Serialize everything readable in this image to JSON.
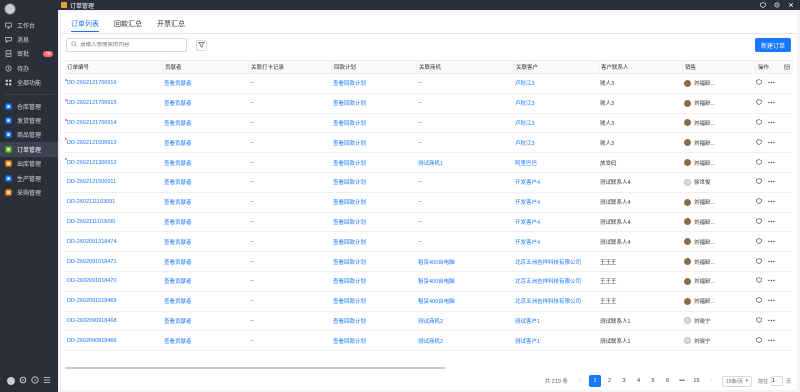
{
  "app": {
    "title": "订单管理"
  },
  "sidebar": {
    "items": [
      {
        "label": "工作台",
        "icon": "monitor-icon"
      },
      {
        "label": "消息",
        "icon": "message-icon"
      },
      {
        "label": "审批",
        "icon": "approval-icon",
        "badge": "76"
      },
      {
        "label": "待办",
        "icon": "todo-icon"
      },
      {
        "label": "全部功能",
        "icon": "grid-icon"
      }
    ],
    "modules": [
      {
        "label": "仓库管理",
        "color": "#1677ff"
      },
      {
        "label": "发货管理",
        "color": "#1677ff"
      },
      {
        "label": "商品管理",
        "color": "#1677ff"
      },
      {
        "label": "订单管理",
        "color": "#52c41a",
        "active": true
      },
      {
        "label": "出库管理",
        "color": "#fa8c16"
      },
      {
        "label": "生产管理",
        "color": "#1677ff"
      },
      {
        "label": "采购管理",
        "color": "#fa8c16"
      }
    ]
  },
  "tabs": [
    {
      "label": "订单列表",
      "active": true
    },
    {
      "label": "回款汇总"
    },
    {
      "label": "开票汇总"
    }
  ],
  "search": {
    "placeholder": "请输入想搜索的内容"
  },
  "toolbar": {
    "new_label": "新建订单"
  },
  "columns": [
    "订单编号",
    "贡献者",
    "关联打卡记录",
    "回款计划",
    "关联商机",
    "关联客户",
    "客户联系人",
    "销售",
    "操作"
  ],
  "rows": [
    {
      "id": "DD-2602121706916",
      "contrib": "查看贡献者",
      "checkin": "--",
      "plan": "查看回款计划",
      "opp": "--",
      "customer": "卢秋江3",
      "contact": "贱人3",
      "sales": "刘福龄...",
      "flag": true,
      "light": false
    },
    {
      "id": "DD-2602121706915",
      "contrib": "查看贡献者",
      "checkin": "--",
      "plan": "查看回款计划",
      "opp": "--",
      "customer": "卢秋江3",
      "contact": "贱人3",
      "sales": "刘福龄...",
      "flag": true,
      "light": false
    },
    {
      "id": "DD-2602121706914",
      "contrib": "查看贡献者",
      "checkin": "--",
      "plan": "查看回款计划",
      "opp": "--",
      "customer": "卢秋江3",
      "contact": "贱人3",
      "sales": "刘福龄...",
      "flag": true,
      "light": false
    },
    {
      "id": "DD-2602121506913",
      "contrib": "查看贡献者",
      "checkin": "--",
      "plan": "查看回款计划",
      "opp": "--",
      "customer": "卢秋江3",
      "contact": "贱人3",
      "sales": "刘福龄...",
      "flag": true,
      "light": false
    },
    {
      "id": "DD-2602121306912",
      "contrib": "查看贡献者",
      "checkin": "--",
      "plan": "查看回款计划",
      "opp": "测试商机1",
      "customer": "阿里巴巴",
      "contact": "放发码",
      "sales": "刘福龄...",
      "flag": true,
      "light": false
    },
    {
      "id": "DD-2602121506911",
      "contrib": "查看贡献者",
      "checkin": "--",
      "plan": "查看回款计划",
      "opp": "--",
      "customer": "开发客户4",
      "contact": "测试联系人4",
      "sales": "徐世俊",
      "flag": false,
      "light": true
    },
    {
      "id": "DD-2602111103091",
      "contrib": "查看贡献者",
      "checkin": "--",
      "plan": "查看回款计划",
      "opp": "--",
      "customer": "开发客户4",
      "contact": "测试联系人4",
      "sales": "刘福龄...",
      "flag": false,
      "light": false
    },
    {
      "id": "DD-2602111103090",
      "contrib": "查看贡献者",
      "checkin": "--",
      "plan": "查看回款计划",
      "opp": "--",
      "customer": "开发客户4",
      "contact": "测试联系人4",
      "sales": "刘福龄...",
      "flag": false,
      "light": false
    },
    {
      "id": "DD-2602091318474",
      "contrib": "查看贡献者",
      "checkin": "--",
      "plan": "查看回款计划",
      "opp": "--",
      "customer": "开发客户4",
      "contact": "测试联系人4",
      "sales": "刘福龄...",
      "flag": false,
      "light": false
    },
    {
      "id": "DD-2602091018471",
      "contrib": "查看贡献者",
      "checkin": "--",
      "plan": "查看回款计划",
      "opp": "租赁400台电脑",
      "customer": "北京五洲吉祥科技有限公司",
      "contact": "王王王",
      "sales": "刘福龄...",
      "flag": false,
      "light": false
    },
    {
      "id": "DD-2602091018470",
      "contrib": "查看贡献者",
      "checkin": "--",
      "plan": "查看回款计划",
      "opp": "租赁400台电脑",
      "customer": "北京五洲吉祥科技有限公司",
      "contact": "王王王",
      "sales": "刘福龄...",
      "flag": false,
      "light": false
    },
    {
      "id": "DD-2602091018469",
      "contrib": "查看贡献者",
      "checkin": "--",
      "plan": "查看回款计划",
      "opp": "租赁400台电脑",
      "customer": "北京五洲吉祥科技有限公司",
      "contact": "王王王",
      "sales": "刘福龄...",
      "flag": false,
      "light": false
    },
    {
      "id": "DD-2602090918468",
      "contrib": "查看贡献者",
      "checkin": "--",
      "plan": "查看回款计划",
      "opp": "测试商机2",
      "customer": "测试客户1",
      "contact": "测试联系人1",
      "sales": "刘晓宁",
      "flag": false,
      "light": true
    },
    {
      "id": "DD-2602090918466",
      "contrib": "查看贡献者",
      "checkin": "--",
      "plan": "查看回款计划",
      "opp": "测试商机2",
      "customer": "测试客户1",
      "contact": "测试联系人1",
      "sales": "刘晓宁",
      "flag": false,
      "light": true
    }
  ],
  "pagination": {
    "total_label": "共 219 条",
    "pages": [
      "1",
      "2",
      "3",
      "4",
      "5",
      "6"
    ],
    "current": "1",
    "ellipsis": "•••",
    "last": "15",
    "page_size": "15条/页",
    "goto_label": "前往",
    "goto_value": "1",
    "goto_suffix": "页"
  }
}
